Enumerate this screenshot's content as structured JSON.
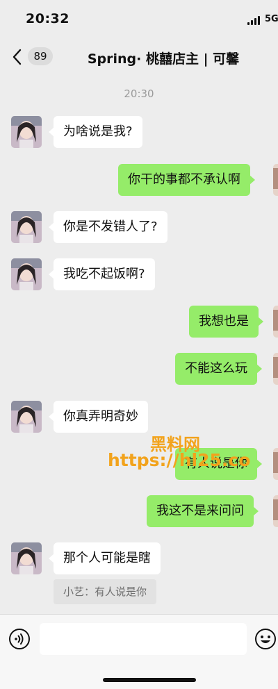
{
  "status_bar": {
    "time": "20:32",
    "network": "5G"
  },
  "header": {
    "unread_count": "89",
    "title": "Spring· 桃囍店主 | 可馨"
  },
  "chat": {
    "timestamp": "20:30",
    "messages": [
      {
        "from": "contact",
        "text": "为啥说是我?"
      },
      {
        "from": "me",
        "text": "你干的事都不承认啊"
      },
      {
        "from": "contact",
        "text": "你是不发错人了?"
      },
      {
        "from": "contact",
        "text": "我吃不起饭啊?"
      },
      {
        "from": "me",
        "text": "我想也是"
      },
      {
        "from": "me",
        "text": "不能这么玩"
      },
      {
        "from": "contact",
        "text": "你真弄明奇妙"
      },
      {
        "from": "me",
        "text": "有人说是你"
      },
      {
        "from": "me",
        "text": "我这不是来问问"
      },
      {
        "from": "contact",
        "text": "那个人可能是瞎"
      }
    ],
    "quote": "小艺：有人说是你"
  },
  "watermark": {
    "brand": "黑料网",
    "url": "https://hl25.co"
  },
  "input_bar": {
    "value": "",
    "placeholder": ""
  },
  "icons": {
    "back": "chevron-left-icon",
    "voice": "voice-icon",
    "emoji": "emoji-icon",
    "signal": "signal-icon"
  },
  "colors": {
    "background": "#ededed",
    "incoming_bubble": "#ffffff",
    "outgoing_bubble": "#95ec69",
    "watermark": "#f2a31c"
  }
}
